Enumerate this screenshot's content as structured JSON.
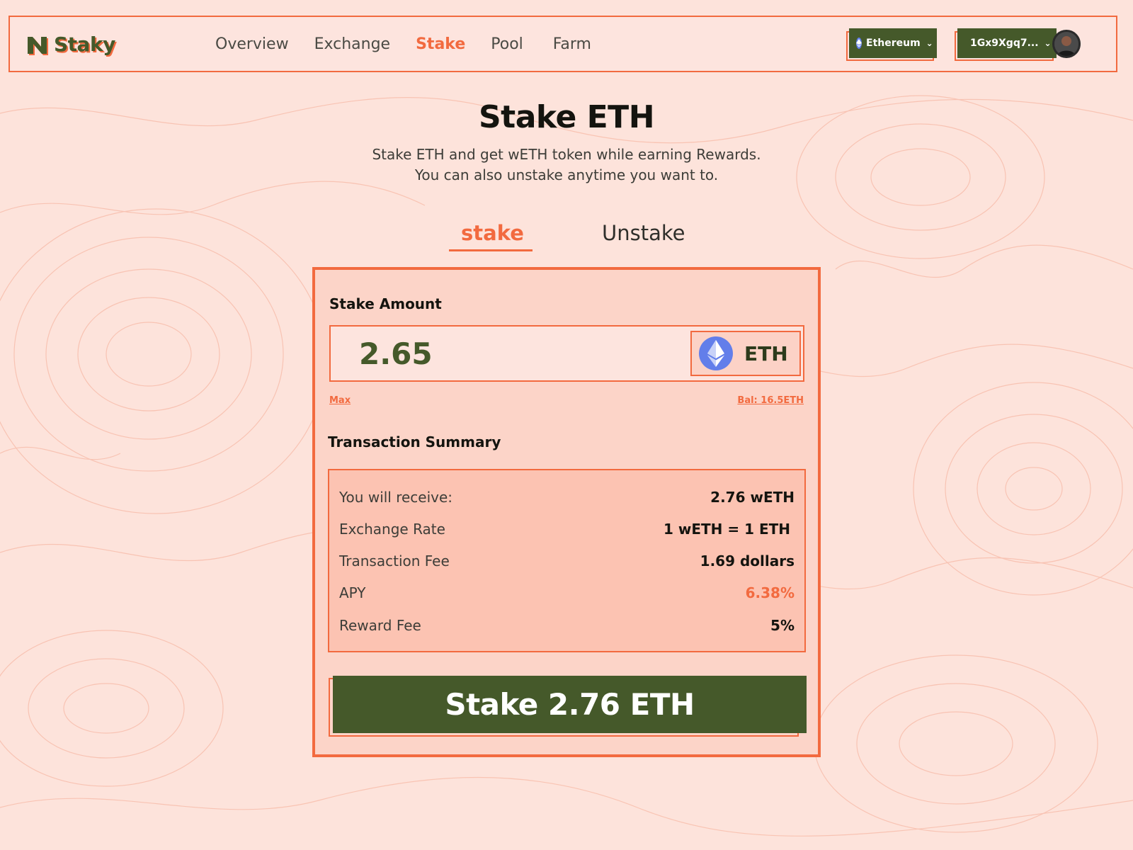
{
  "app": {
    "name": "Staky"
  },
  "nav": {
    "items": [
      {
        "label": "Overview"
      },
      {
        "label": "Exchange"
      },
      {
        "label": "Stake"
      },
      {
        "label": "Pool"
      },
      {
        "label": "Farm"
      }
    ],
    "active": "Stake"
  },
  "network": {
    "label": "Ethereum"
  },
  "wallet": {
    "address": "1Gx9Xgq7..."
  },
  "page": {
    "title": "Stake ETH",
    "subtitle_line1": "Stake ETH and get wETH token while earning Rewards.",
    "subtitle_line2": "You can also unstake anytime you want to."
  },
  "tabs": [
    {
      "label": "stake",
      "active": true
    },
    {
      "label": "Unstake",
      "active": false
    }
  ],
  "stake": {
    "amount_label": "Stake Amount",
    "amount_value": "2.65",
    "token": "ETH",
    "max_label": "Max",
    "balance_label": "Bal: 16.5ETH"
  },
  "summary": {
    "title": "Transaction Summary",
    "rows": [
      {
        "label": "You will receive:",
        "value": "2.76 wETH"
      },
      {
        "label": "Exchange Rate",
        "value": "1 wETH = 1 ETH"
      },
      {
        "label": "Transaction Fee",
        "value": "1.69 dollars"
      },
      {
        "label": "APY",
        "value": "6.38%"
      },
      {
        "label": "Reward Fee",
        "value": "5%"
      }
    ]
  },
  "cta": {
    "label": "Stake 2.76 ETH"
  },
  "colors": {
    "accent": "#f26a3f",
    "primary_green": "#45592a",
    "background": "#fde3db",
    "eth_blue": "#627eea"
  }
}
